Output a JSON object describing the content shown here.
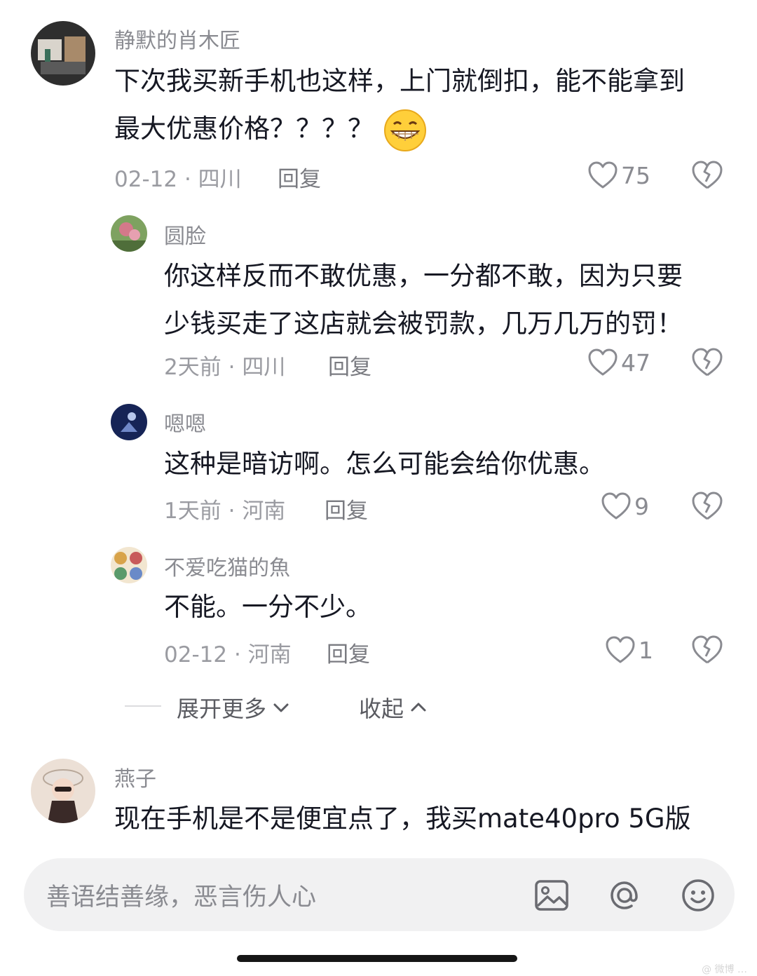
{
  "comments": [
    {
      "username": "静默的肖木匠",
      "lines": [
        "下次我买新手机也这样，上门就倒扣，能不能拿到",
        "最大优惠价格？？？？"
      ],
      "emoji": "grinning-face-emoji",
      "date": "02-12",
      "location": "四川",
      "reply_label": "回复",
      "likes": "75",
      "avatar_colors": [
        "#2b2b2b",
        "#8a7a6a"
      ]
    },
    {
      "username": "圆脸",
      "lines": [
        "你这样反而不敢优惠，一分都不敢，因为只要",
        "少钱买走了这店就会被罚款，几万几万的罚！"
      ],
      "date": "2天前",
      "location": "四川",
      "reply_label": "回复",
      "likes": "47",
      "avatar_colors": [
        "#6b8f4e",
        "#c86a7a"
      ]
    },
    {
      "username": "嗯嗯",
      "lines": [
        "这种是暗访啊。怎么可能会给你优惠。"
      ],
      "date": "1天前",
      "location": "河南",
      "reply_label": "回复",
      "likes": "9",
      "avatar_colors": [
        "#1c2a5a",
        "#8fa6d8"
      ]
    },
    {
      "username": "不爱吃猫的魚",
      "lines": [
        "不能。一分不少。"
      ],
      "date": "02-12",
      "location": "河南",
      "reply_label": "回复",
      "likes": "1",
      "avatar_colors": [
        "#d8a34a",
        "#5a9a6a"
      ]
    },
    {
      "username": "燕子",
      "lines": [
        "现在手机是不是便宜点了，我买mate40pro 5G版"
      ],
      "avatar_colors": [
        "#e9d6cc",
        "#3a2a28"
      ]
    }
  ],
  "thread": {
    "expand_label": "展开更多",
    "collapse_label": "收起"
  },
  "input": {
    "placeholder": "善语结善缘，恶言伤人心",
    "icons": [
      "image-icon",
      "at-icon",
      "emoji-icon"
    ]
  },
  "meta_separator": "·",
  "watermark": "@ 微博 …"
}
